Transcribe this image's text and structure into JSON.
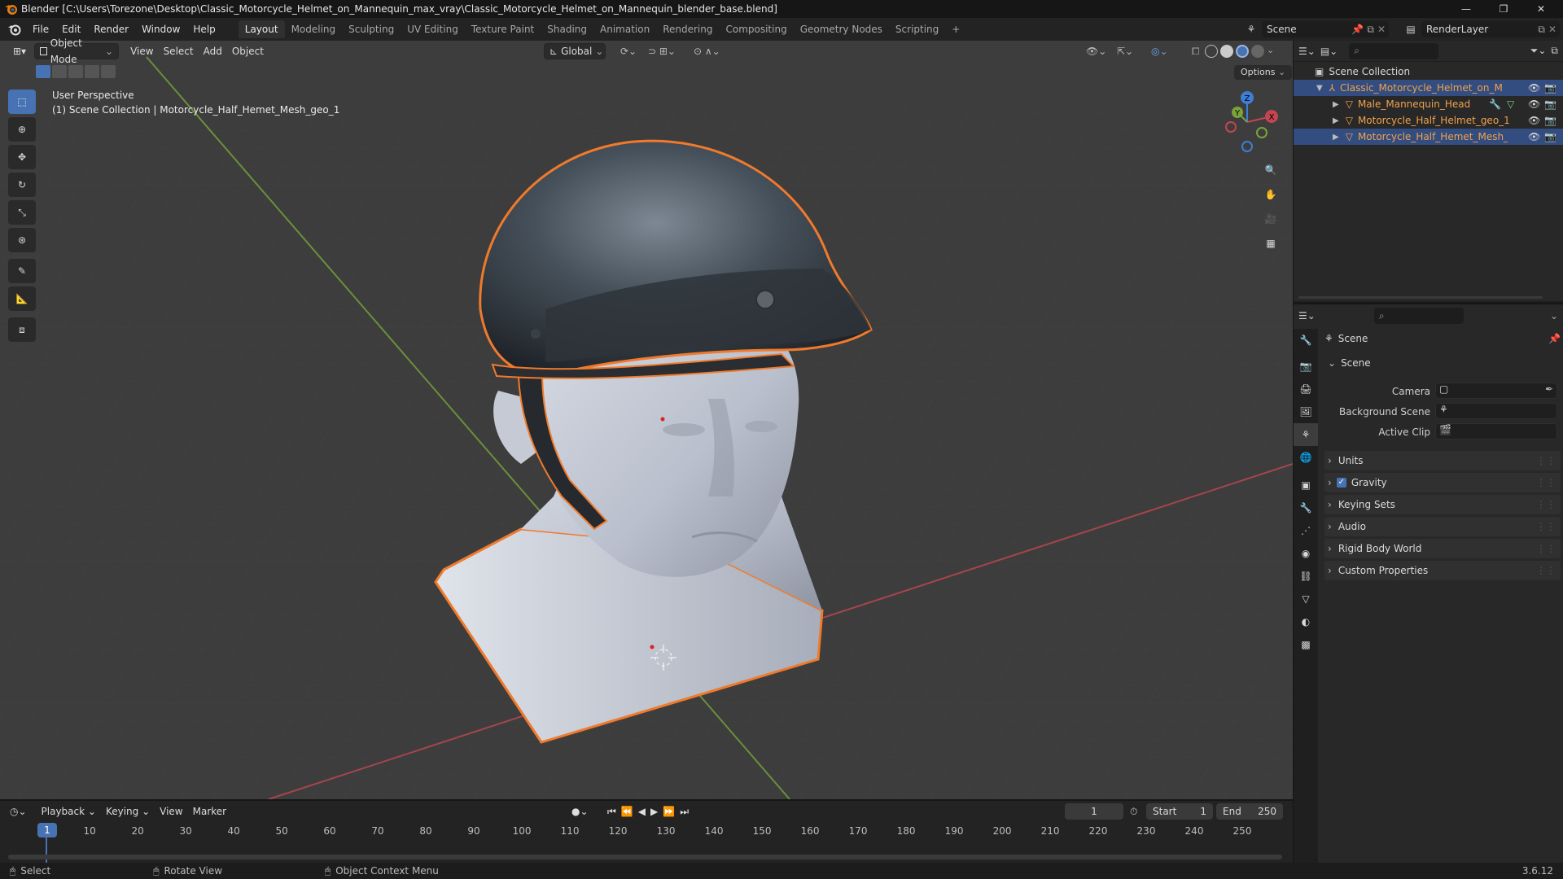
{
  "window": {
    "title": "Blender [C:\\Users\\Torezone\\Desktop\\Classic_Motorcycle_Helmet_on_Mannequin_max_vray\\Classic_Motorcycle_Helmet_on_Mannequin_blender_base.blend]",
    "minimize": "—",
    "restore": "❐",
    "close": "✕"
  },
  "menu": [
    "File",
    "Edit",
    "Render",
    "Window",
    "Help"
  ],
  "workspaces": [
    "Layout",
    "Modeling",
    "Sculpting",
    "UV Editing",
    "Texture Paint",
    "Shading",
    "Animation",
    "Rendering",
    "Compositing",
    "Geometry Nodes",
    "Scripting",
    "+"
  ],
  "active_workspace": "Layout",
  "scene_selector": "Scene",
  "view_layer": "RenderLayer",
  "viewport": {
    "mode": "Object Mode",
    "menus": [
      "View",
      "Select",
      "Add",
      "Object"
    ],
    "orientation": "Global",
    "options_label": "Options",
    "perspective_label": "User Perspective",
    "context_label": "(1) Scene Collection | Motorcycle_Half_Hemet_Mesh_geo_1",
    "gizmo_axes": {
      "x": "X",
      "y": "Y",
      "z": "Z"
    }
  },
  "outliner": {
    "root": "Scene Collection",
    "items": [
      {
        "label": "Classic_Motorcycle_Helmet_on_Mannec",
        "depth": 1,
        "selected": true,
        "icon": "empty-icon"
      },
      {
        "label": "Male_Mannequin_Head",
        "depth": 2,
        "selected": false,
        "icon": "mesh-icon"
      },
      {
        "label": "Motorcycle_Half_Helmet_geo_1",
        "depth": 2,
        "selected": false,
        "icon": "mesh-icon"
      },
      {
        "label": "Motorcycle_Half_Hemet_Mesh_geo",
        "depth": 2,
        "selected": true,
        "icon": "mesh-icon"
      }
    ]
  },
  "properties": {
    "context_title": "Scene",
    "panel_title": "Scene",
    "fields": [
      {
        "label": "Camera",
        "value": ""
      },
      {
        "label": "Background Scene",
        "value": ""
      },
      {
        "label": "Active Clip",
        "value": ""
      }
    ],
    "subpanels": [
      "Units",
      "Gravity",
      "Keying Sets",
      "Audio",
      "Rigid Body World",
      "Custom Properties"
    ],
    "gravity_checked": true
  },
  "timeline": {
    "menus": [
      "Playback",
      "Keying",
      "View",
      "Marker"
    ],
    "current_frame": "1",
    "start_label": "Start",
    "start": "1",
    "end_label": "End",
    "end": "250",
    "ticks": [
      "1",
      "10",
      "20",
      "30",
      "40",
      "50",
      "60",
      "70",
      "80",
      "90",
      "100",
      "110",
      "120",
      "130",
      "140",
      "150",
      "160",
      "170",
      "180",
      "190",
      "200",
      "210",
      "220",
      "230",
      "240",
      "250"
    ]
  },
  "statusbar": {
    "select": "Select",
    "rotate": "Rotate View",
    "context_menu": "Object Context Menu",
    "version": "3.6.12"
  },
  "colors": {
    "accent": "#4772b3",
    "selection_outline": "#f07a2c",
    "outliner_selected": "#334d80",
    "object_name_orange": "#f0a24c",
    "axis_x": "#c4454f",
    "axis_y": "#7aa33a",
    "axis_z": "#3c7fd6"
  }
}
